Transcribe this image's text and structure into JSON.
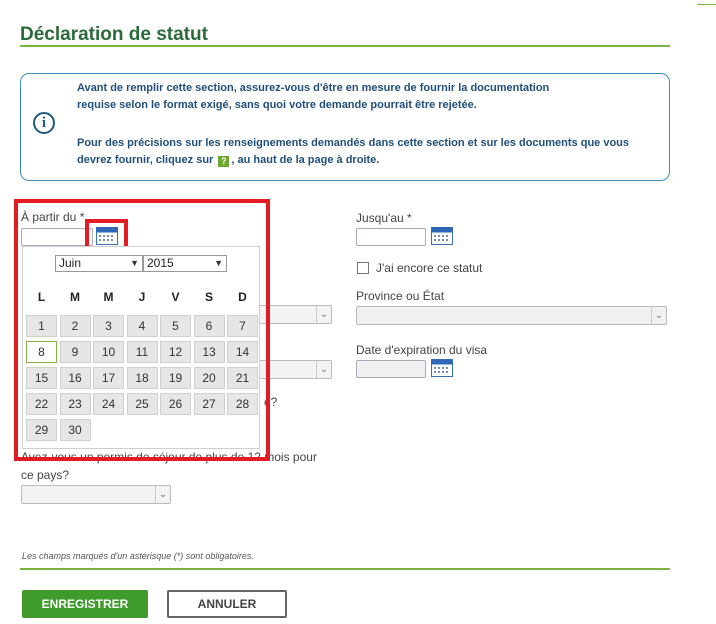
{
  "header": {
    "title": "Déclaration de statut"
  },
  "info": {
    "line1": "Avant de remplir cette section, assurez-vous d'être en mesure de fournir la documentation",
    "line2": "requise selon le format exigé, sans quoi votre demande pourrait être rejetée.",
    "line3": "Pour des précisions sur les renseignements demandés dans cette section et sur les documents que vous",
    "line4a": "devrez fournir, cliquez sur",
    "help_glyph": "?",
    "line4b": ", au haut de la page à droite."
  },
  "form": {
    "from_label": "À partir du *",
    "to_label": "Jusqu'au *",
    "still_status_label": "J'ai encore ce statut",
    "province_label": "Province ou État",
    "visa_expiry_label": "Date d'expiration du visa",
    "partial_q_suffix": "e?",
    "permit_question_line1": "Avez-vous un permis de séjour de plus de 12 mois pour",
    "permit_question_line2": "ce pays?"
  },
  "datepicker": {
    "month": "Juin",
    "year": "2015",
    "weekdays": [
      "L",
      "M",
      "M",
      "J",
      "V",
      "S",
      "D"
    ],
    "weeks": [
      [
        "1",
        "2",
        "3",
        "4",
        "5",
        "6",
        "7"
      ],
      [
        "8",
        "9",
        "10",
        "11",
        "12",
        "13",
        "14"
      ],
      [
        "15",
        "16",
        "17",
        "18",
        "19",
        "20",
        "21"
      ],
      [
        "22",
        "23",
        "24",
        "25",
        "26",
        "27",
        "28"
      ],
      [
        "29",
        "30"
      ]
    ],
    "today": "8"
  },
  "footer": {
    "required_note": "Les champs marqués d'un astérisque (*) sont obligatoires.",
    "save_label": "ENREGISTRER",
    "cancel_label": "ANNULER"
  },
  "colors": {
    "accent_green": "#7bb342",
    "title_green": "#2b6b3a",
    "highlight_red": "#e31b23",
    "info_blue": "#1f4f7a"
  }
}
